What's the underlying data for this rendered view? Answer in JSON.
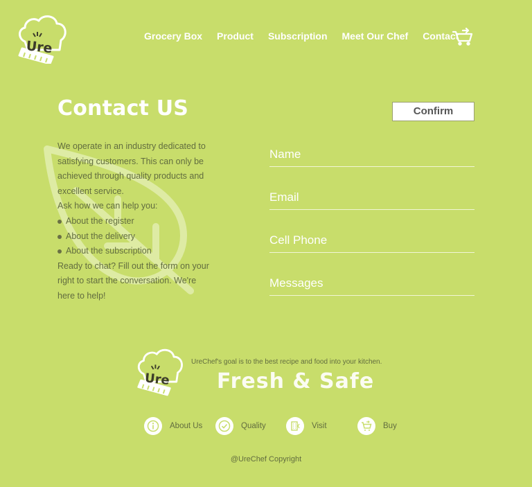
{
  "brand": {
    "logo_text": "Ure"
  },
  "nav": {
    "items": [
      "Grocery Box",
      "Product",
      "Subscription",
      "Meet Our Chef",
      "Contact"
    ],
    "cart_icon": "cart-icon"
  },
  "contact": {
    "title": "Contact US",
    "confirm_label": "Confirm",
    "intro": "We operate in an industry dedicated to satisfying customers. This can only be achieved through quality products and excellent service.",
    "ask": "Ask how we can help you:",
    "topics": [
      "About the register",
      "About the delivery",
      "About the subscription"
    ],
    "outro": "Ready to chat? Fill out the form on your right to start the conversation. We're here to help!"
  },
  "form": {
    "name_placeholder": "Name",
    "email_placeholder": "Email",
    "phone_placeholder": "Cell Phone",
    "messages_placeholder": "Messages"
  },
  "footer": {
    "goal": "UreChef's goal is to the best recipe and food into your kitchen.",
    "slogan": "Fresh & Safe",
    "links": [
      {
        "label": "About Us",
        "icon": "info-icon"
      },
      {
        "label": "Quality",
        "icon": "check-badge-icon"
      },
      {
        "label": "Visit",
        "icon": "building-icon"
      },
      {
        "label": "Buy",
        "icon": "cart-icon"
      }
    ],
    "copyright": "@UreChef Copyright"
  },
  "colors": {
    "background": "#c8dd6b",
    "text": "#626d3f",
    "accent": "#ffffff"
  }
}
